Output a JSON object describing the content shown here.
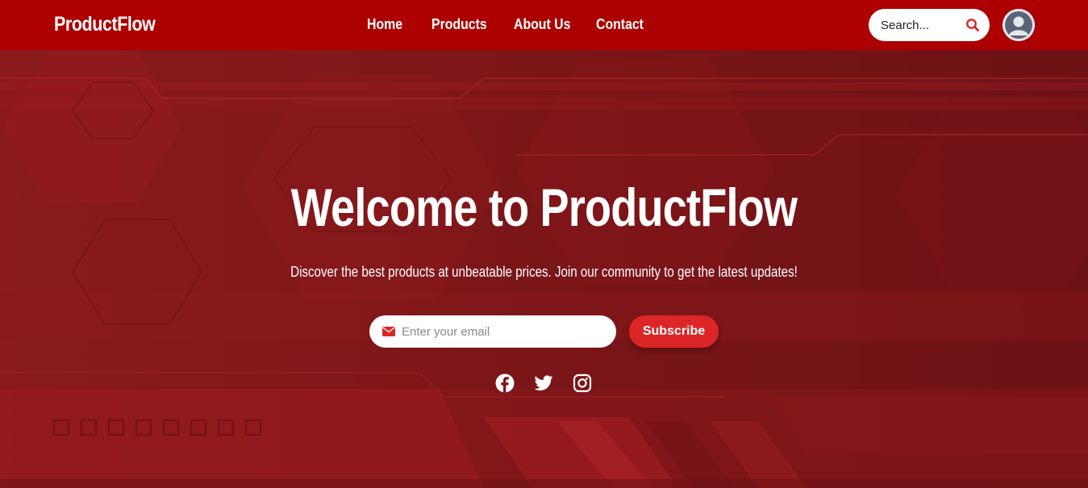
{
  "brand": {
    "name": "ProductFlow"
  },
  "nav": {
    "links": [
      {
        "label": "Home"
      },
      {
        "label": "Products"
      },
      {
        "label": "About Us"
      },
      {
        "label": "Contact"
      }
    ]
  },
  "search": {
    "placeholder": "Search...",
    "icon": "search-icon"
  },
  "user": {
    "avatar_icon": "user-avatar-icon"
  },
  "hero": {
    "title": "Welcome to ProductFlow",
    "subtitle": "Discover the best products at unbeatable prices. Join our community to get the latest updates!",
    "email_placeholder": "Enter your email",
    "subscribe_label": "Subscribe"
  },
  "social": [
    {
      "icon": "facebook-icon"
    },
    {
      "icon": "twitter-icon"
    },
    {
      "icon": "instagram-icon"
    }
  ],
  "colors": {
    "navbar": "#ad0000",
    "hero_bg": "#7d1619",
    "accent": "#dc2626",
    "text": "#ffffff"
  }
}
